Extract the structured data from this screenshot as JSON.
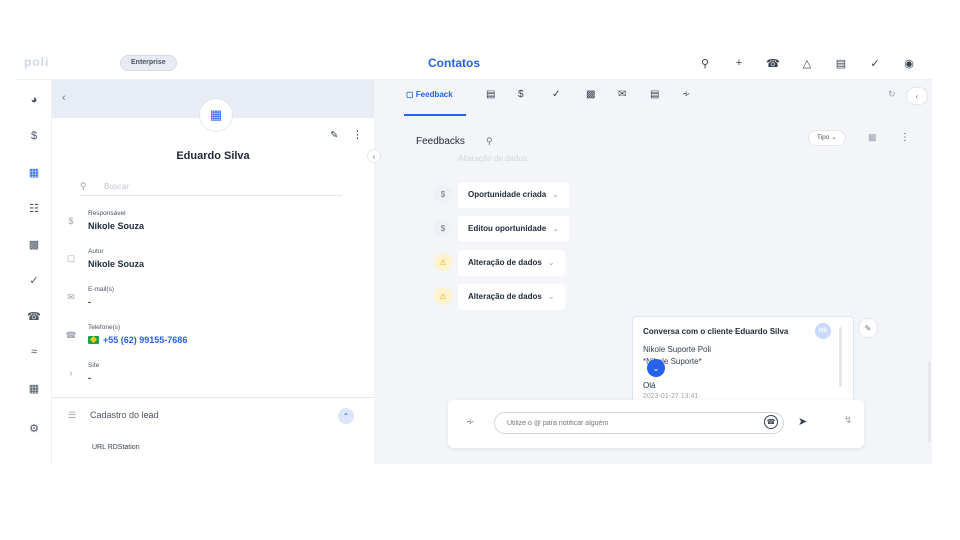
{
  "app": {
    "logo_text": "poli",
    "plan_badge": "Enterprise",
    "page_title": "Contatos"
  },
  "topbar_icons": [
    "search-icon",
    "plus-icon",
    "phone-icon",
    "bell-icon",
    "inbox-icon",
    "check-circle-icon",
    "account-icon"
  ],
  "rail_icons": [
    "pie-chart-icon",
    "dollar-icon",
    "building-icon",
    "kanban-icon",
    "calendar-icon",
    "check-circle-icon",
    "phone-icon",
    "chart-icon",
    "widgets-icon",
    "gear-icon"
  ],
  "contact": {
    "name": "Eduardo Silva",
    "search_placeholder": "Buscar",
    "fields": [
      {
        "label": "Responsável",
        "value": "Nikole Souza",
        "icon": "dollar-icon"
      },
      {
        "label": "Autor",
        "value": "Nikole Souza",
        "icon": "edit-box-icon"
      },
      {
        "label": "E-mail(s)",
        "value": "-",
        "icon": "mail-icon"
      },
      {
        "label": "Telefone(s)",
        "value": "+55 (62) 99155-7686",
        "icon": "phone-icon"
      },
      {
        "label": "Site",
        "value": "-",
        "icon": "chevron-right-icon"
      }
    ],
    "lead_section_title": "Cadastro do lead",
    "lead_field_label": "URL RDStation"
  },
  "tabs": {
    "active_label": "Feedback"
  },
  "feed": {
    "title": "Feedbacks",
    "filter_label": "Tipo",
    "faded_event": "Alteração de dados",
    "events": [
      {
        "label": "Oportunidade criada",
        "kind": "dollar"
      },
      {
        "label": "Editou oportunidade",
        "kind": "dollar"
      },
      {
        "label": "Alteração de dados",
        "kind": "warn"
      },
      {
        "label": "Alteração de dados",
        "kind": "warn"
      }
    ]
  },
  "conversation": {
    "title": "Conversa com o cliente Eduardo Silva",
    "avatar_initials": "NS",
    "line1": "Nikole Suporte Poli",
    "line2": "*Nikole Suporte*",
    "line3": "Olá",
    "line4": "2023-01-27 13:41"
  },
  "composer": {
    "placeholder": "Utilize o @ para notificar alguém"
  },
  "colors": {
    "accent": "#2563eb",
    "warning": "#eab308",
    "background": "#f3f5f9"
  }
}
